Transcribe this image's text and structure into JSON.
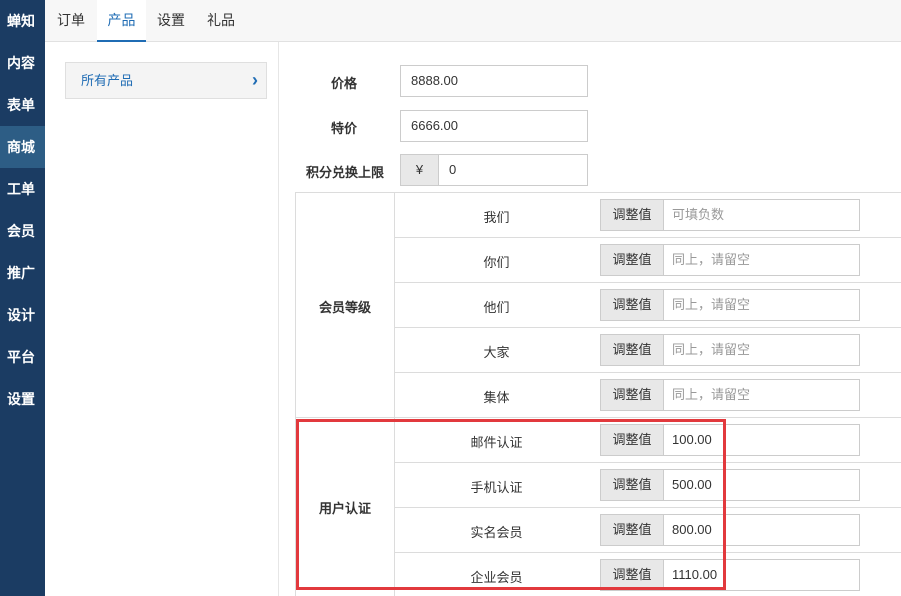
{
  "sidebar": {
    "items": [
      {
        "label": "蝉知",
        "active": false
      },
      {
        "label": "内容",
        "active": false
      },
      {
        "label": "表单",
        "active": false
      },
      {
        "label": "商城",
        "active": true
      },
      {
        "label": "工单",
        "active": false
      },
      {
        "label": "会员",
        "active": false
      },
      {
        "label": "推广",
        "active": false
      },
      {
        "label": "设计",
        "active": false
      },
      {
        "label": "平台",
        "active": false
      },
      {
        "label": "设置",
        "active": false
      }
    ]
  },
  "tabs": [
    {
      "label": "订单",
      "active": false
    },
    {
      "label": "产品",
      "active": true
    },
    {
      "label": "设置",
      "active": false
    },
    {
      "label": "礼品",
      "active": false
    }
  ],
  "subnav": {
    "label": "所有产品",
    "chevron": "›"
  },
  "form": {
    "price": {
      "label": "价格",
      "value": "8888.00"
    },
    "special_price": {
      "label": "特价",
      "value": "6666.00"
    },
    "points_limit": {
      "label": "积分兑换上限",
      "prefix": "¥",
      "value": "0"
    }
  },
  "groups": [
    {
      "label": "会员等级",
      "rows": [
        {
          "label": "我们",
          "addon": "调整值",
          "value": "",
          "placeholder": "可填负数"
        },
        {
          "label": "你们",
          "addon": "调整值",
          "value": "",
          "placeholder": "同上，请留空"
        },
        {
          "label": "他们",
          "addon": "调整值",
          "value": "",
          "placeholder": "同上，请留空"
        },
        {
          "label": "大家",
          "addon": "调整值",
          "value": "",
          "placeholder": "同上，请留空"
        },
        {
          "label": "集体",
          "addon": "调整值",
          "value": "",
          "placeholder": "同上，请留空"
        }
      ]
    },
    {
      "label": "用户认证",
      "rows": [
        {
          "label": "邮件认证",
          "addon": "调整值",
          "value": "100.00",
          "placeholder": ""
        },
        {
          "label": "手机认证",
          "addon": "调整值",
          "value": "500.00",
          "placeholder": ""
        },
        {
          "label": "实名会员",
          "addon": "调整值",
          "value": "800.00",
          "placeholder": ""
        },
        {
          "label": "企业会员",
          "addon": "调整值",
          "value": "1110.00",
          "placeholder": ""
        }
      ]
    }
  ],
  "colors": {
    "sidebar": "#1b3c63",
    "sidebar_active": "#2d5d85",
    "accent": "#1f6cb4",
    "highlight": "#e2393d"
  }
}
